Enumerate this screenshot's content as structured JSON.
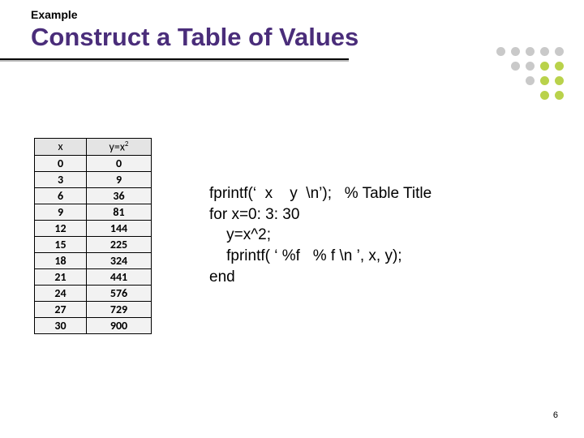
{
  "header": {
    "label": "Example",
    "title": "Construct a Table of Values"
  },
  "table": {
    "col1_header": "x",
    "col2_header_base": "y=x",
    "col2_header_exp": "2",
    "rows": [
      {
        "x": "0",
        "y": "0"
      },
      {
        "x": "3",
        "y": "9"
      },
      {
        "x": "6",
        "y": "36"
      },
      {
        "x": "9",
        "y": "81"
      },
      {
        "x": "12",
        "y": "144"
      },
      {
        "x": "15",
        "y": "225"
      },
      {
        "x": "18",
        "y": "324"
      },
      {
        "x": "21",
        "y": "441"
      },
      {
        "x": "24",
        "y": "576"
      },
      {
        "x": "27",
        "y": "729"
      },
      {
        "x": "30",
        "y": "900"
      }
    ]
  },
  "code": {
    "line1": "fprintf(‘  x    y  \\n’);   % Table Title",
    "line2": "for x=0: 3: 30",
    "line3": "    y=x^2;",
    "line4": "    fprintf( ‘ %f   % f \\n ’, x, y);",
    "line5": "end"
  },
  "page_number": "6",
  "chart_data": {
    "type": "table",
    "title": "y = x^2 from 0 to 30 step 3",
    "columns": [
      "x",
      "y=x^2"
    ],
    "rows": [
      [
        0,
        0
      ],
      [
        3,
        9
      ],
      [
        6,
        36
      ],
      [
        9,
        81
      ],
      [
        12,
        144
      ],
      [
        15,
        225
      ],
      [
        18,
        324
      ],
      [
        21,
        441
      ],
      [
        24,
        576
      ],
      [
        27,
        729
      ],
      [
        30,
        900
      ]
    ]
  }
}
